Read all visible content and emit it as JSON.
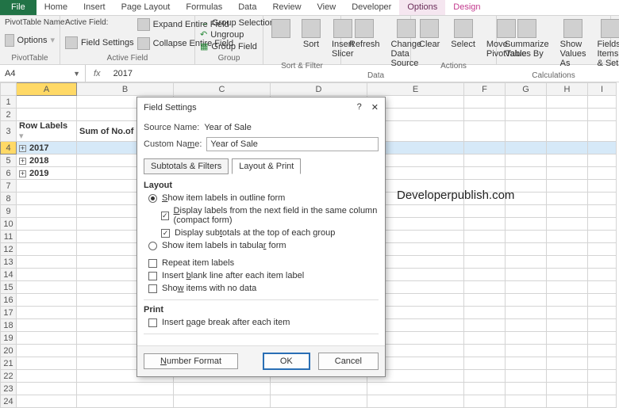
{
  "tabs": {
    "file": "File",
    "home": "Home",
    "insert": "Insert",
    "pagelayout": "Page Layout",
    "formulas": "Formulas",
    "data": "Data",
    "review": "Review",
    "view": "View",
    "developer": "Developer",
    "options": "Options",
    "design": "Design"
  },
  "ribbon": {
    "pivotNameLbl": "PivotTable Name:",
    "activeFieldLbl": "Active Field:",
    "optionsBtn": "Options",
    "pivotGroup": "PivotTable",
    "fieldSettings": "Field Settings",
    "activeFieldGroup": "Active Field",
    "expandField": "Expand Entire Field",
    "collapseField": "Collapse Entire Field",
    "groupSelection": "Group Selection",
    "ungroup": "Ungroup",
    "groupField": "Group Field",
    "groupGroup": "Group",
    "sort": "Sort",
    "insertSlicer": "Insert Slicer",
    "sortFilterGroup": "Sort & Filter",
    "refresh": "Refresh",
    "changeSource": "Change Data Source",
    "dataGroup": "Data",
    "clear": "Clear",
    "select": "Select",
    "movePivot": "Move PivotTable",
    "actionsGroup": "Actions",
    "summarize": "Summarize Values By",
    "showAs": "Show Values As",
    "fieldsItems": "Fields, Items & Sets",
    "calcGroup": "Calculations"
  },
  "nameBox": "A4",
  "fx": "fx",
  "formula": "2017",
  "cols": [
    "A",
    "B",
    "C",
    "D",
    "E",
    "F",
    "G",
    "H",
    "I"
  ],
  "rows": {
    "r3a": "Row Labels",
    "r3b": "Sum of No.of I",
    "r4": "2017",
    "r5": "2018",
    "r6": "2019"
  },
  "watermark": "Developerpublish.com",
  "dlg": {
    "title": "Field Settings",
    "help": "?",
    "close": "✕",
    "sourceLbl": "Source Name:",
    "sourceVal": "Year of Sale",
    "customLbl": "Custom Name:",
    "customVal": "Year of Sale",
    "tab1": "Subtotals & Filters",
    "tab2": "Layout & Print",
    "layoutHdr": "Layout",
    "opt1": "Show item labels in outline form",
    "opt1a": "Display labels from the next field in the same column (compact form)",
    "opt1b": "Display subtotals at the top of each group",
    "opt2": "Show item labels in tabular form",
    "chk1": "Repeat item labels",
    "chk2": "Insert blank line after each item label",
    "chk3": "Show items with no data",
    "printHdr": "Print",
    "chk4": "Insert page break after each item",
    "numFmt": "Number Format",
    "ok": "OK",
    "cancel": "Cancel"
  }
}
